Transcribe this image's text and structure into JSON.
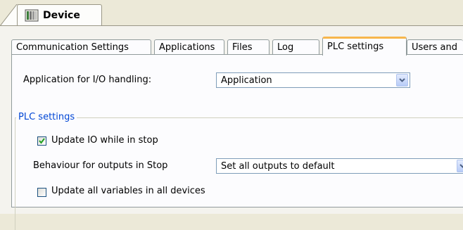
{
  "document_tab": {
    "title": "Device",
    "icon": "device-icon"
  },
  "tabs": [
    {
      "label": "Communication Settings"
    },
    {
      "label": "Applications"
    },
    {
      "label": "Files"
    },
    {
      "label": "Log"
    },
    {
      "label": "PLC settings",
      "active": true
    },
    {
      "label": "Users and"
    }
  ],
  "io_handling": {
    "label": "Application for I/O handling:",
    "value": "Application"
  },
  "plc_group": {
    "title": "PLC settings",
    "update_io": {
      "label": "Update IO while in stop",
      "checked": true
    },
    "behaviour": {
      "label": "Behaviour for outputs in Stop",
      "value": "Set all outputs to default"
    },
    "update_vars": {
      "label": "Update all variables in all devices",
      "checked": false
    }
  },
  "colors": {
    "accent_tab": "#f7b64b",
    "group_title": "#0046d5",
    "check": "#21a121"
  }
}
